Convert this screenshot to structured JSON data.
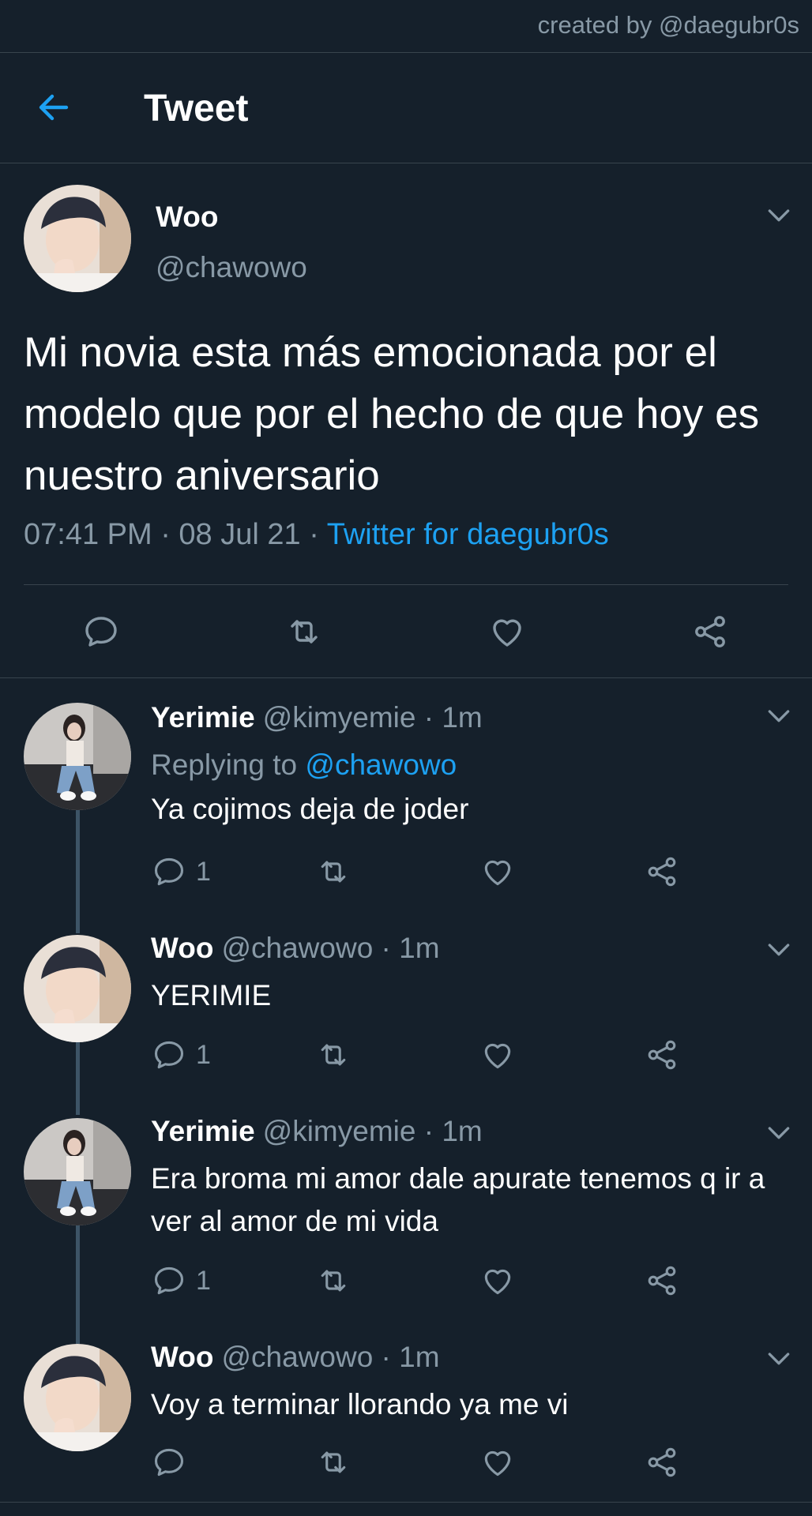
{
  "credit": "created by @daegubr0s",
  "header": {
    "title": "Tweet",
    "back_icon": "arrow-left-icon"
  },
  "colors": {
    "background": "#15202b",
    "accent": "#1da1f2",
    "muted": "#8899a6",
    "divider": "#38444d"
  },
  "main_tweet": {
    "name": "Woo",
    "handle": "@chawowo",
    "text": "Mi novia esta más emocionada por el modelo que por el hecho de que hoy es nuestro aniversario",
    "time": "07:41 PM · 08 Jul 21 · ",
    "source": "Twitter for daegubr0s"
  },
  "replies": [
    {
      "name": "Yerimie",
      "meta": "@kimyemie · 1m",
      "replying_label": "Replying to ",
      "replying_to": "@chawowo",
      "text": "Ya cojimos deja de joder",
      "reply_count": "1"
    },
    {
      "name": "Woo",
      "meta": "@chawowo · 1m",
      "text": "YERIMIE",
      "reply_count": "1"
    },
    {
      "name": "Yerimie",
      "meta": "@kimyemie · 1m",
      "text": "Era broma mi amor dale apurate tenemos q ir a ver al amor de mi vida",
      "reply_count": "1"
    },
    {
      "name": "Woo",
      "meta": "@chawowo · 1m",
      "text": "Voy a terminar llorando ya me vi",
      "reply_count": ""
    }
  ]
}
